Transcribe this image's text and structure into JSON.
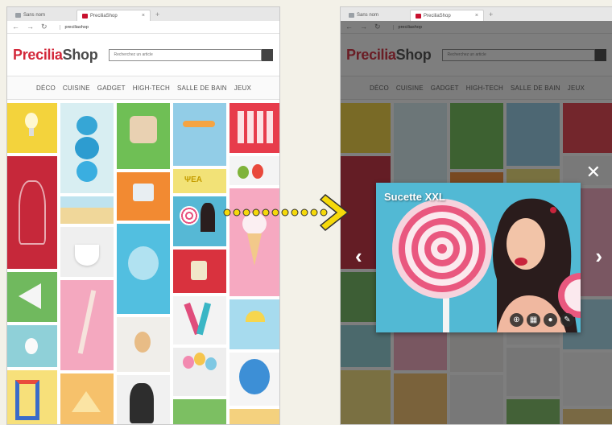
{
  "browser": {
    "inactive_tab_label": "Sans nom",
    "active_tab_label": "PreciliaShop",
    "tab_close": "×",
    "new_tab": "+",
    "url": "preciliashop"
  },
  "site": {
    "logo_part1": "Precilia",
    "logo_part2": "Shop",
    "search_placeholder": "Recherchez un article",
    "categories": [
      "DÉCO",
      "CUISINE",
      "GADGET",
      "HIGH-TECH",
      "SALLE DE BAIN",
      "JEUX"
    ]
  },
  "lightbox": {
    "title": "Sucette XXL",
    "close": "✕",
    "prev": "‹",
    "next": "›",
    "actions": [
      "zoom-icon",
      "grid-icon",
      "user-icon",
      "edit-icon"
    ]
  },
  "colors": {
    "brand_red": "#d3283a",
    "brand_grey": "#4a4a4a",
    "arrow_yellow": "#f5d90a",
    "lightbox_bg": "#52b9d4"
  }
}
